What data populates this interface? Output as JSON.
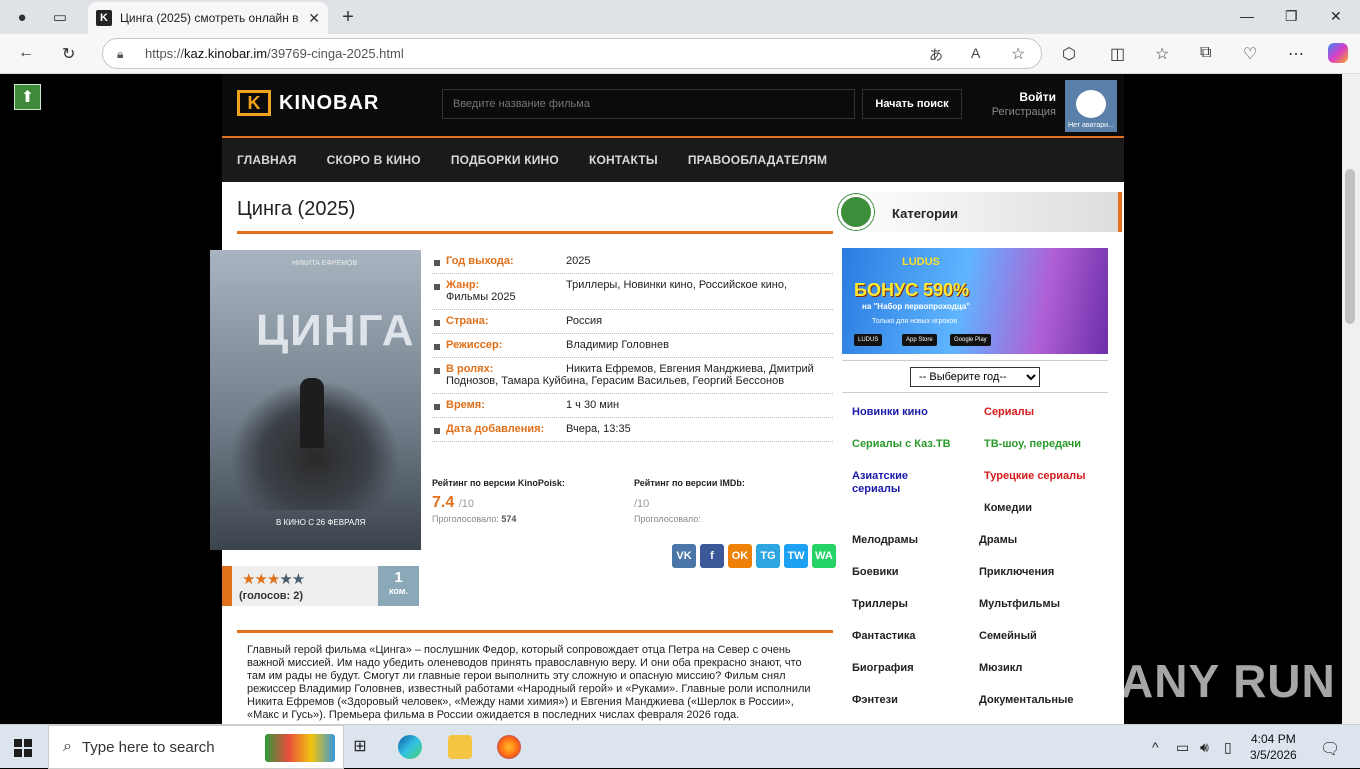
{
  "browser": {
    "tab_title": "Цинга (2025) смотреть онлайн в",
    "url_prefix": "https://",
    "url_domain": "kaz.kinobar.im",
    "url_path": "/39769-cinga-2025.html"
  },
  "site": {
    "logo_text": "KINOBAR",
    "search_placeholder": "Введите название фильма",
    "search_button": "Начать поиск",
    "login": "Войти",
    "register": "Регистрация",
    "avatar_caption": "Нет аватари...",
    "menu": [
      "ГЛАВНАЯ",
      "СКОРО В КИНО",
      "ПОДБОРКИ КИНО",
      "КОНТАКТЫ",
      "ПРАВООБЛАДАТЕЛЯМ"
    ]
  },
  "movie": {
    "title": "Цинга (2025)",
    "poster_title": "ЦИНГА",
    "poster_actor": "НИКИТА ЕФРЕМОВ",
    "poster_release": "В КИНО С 26 ФЕВРАЛЯ",
    "year_label": "Год выхода:",
    "year": "2025",
    "genre_label": "Жанр:",
    "genre": "Триллеры, Новинки кино, Российское кино,",
    "genre_cont": "Фильмы 2025",
    "country_label": "Страна:",
    "country": "Россия",
    "director_label": "Режиссер:",
    "director": "Владимир Головнев",
    "cast_label": "В ролях:",
    "cast": "Никита Ефремов, Евгения Манджиева, Дмитрий",
    "cast_cont": "Поднозов, Тамара Куйбина, Герасим Васильев, Георгий Бессонов",
    "time_label": "Время:",
    "time": "1 ч 30 мин",
    "added_label": "Дата добавления:",
    "added": "Вчера, 13:35",
    "votes": "(голосов: 2)",
    "stars": 3,
    "comments_count": "1",
    "comments_label": "ком."
  },
  "ratings": {
    "kp_label": "Рейтинг по версии KinoPoisk:",
    "kp_score": "7.4",
    "kp_max": "/10",
    "kp_votes_label": "Проголосовало:",
    "kp_votes": "574",
    "imdb_label": "Рейтинг по версии IMDb:",
    "imdb_max": "/10",
    "imdb_votes_label": "Проголосовало:"
  },
  "social": [
    "VK",
    "f",
    "OK",
    "TG",
    "TW",
    "WA"
  ],
  "description": "Главный герой фильма «Цинга» – послушник Федор, который сопровождает отца Петра на Север с очень важной миссией. Им надо убедить оленеводов принять православную веру. И они оба прекрасно знают, что там им рады не будут. Смогут ли главные герои выполнить эту сложную и опасную миссию? Фильм снял режиссер Владимир Головнев, известный работами «Народный герой» и «Руками». Главные роли исполнили Никита Ефремов («Здоровый человек», «Между нами химия») и Евгения Манджиева («Шерлок в России», «Макс и Гусь»). Премьера фильма в России ожидается в последних числах февраля 2026 года.",
  "sidebar": {
    "title": "Категории",
    "banner_brand": "LUDUS",
    "banner_bonus": "БОНУС 590%",
    "banner_line": "на \"Набор первопроходца\"",
    "banner_small": "Только для новых игроков",
    "banner_btn1": "LUDUS",
    "banner_btn2": "App Store",
    "banner_btn3": "Google Play",
    "year_select": "-- Выберите год--",
    "cats": [
      "Новинки кино",
      "Сериалы",
      "Сериалы с Каз.ТВ",
      "ТВ-шоу, передачи",
      "Азиатские сериалы",
      "Турецкие сериалы",
      "Комедии",
      "Мелодрамы",
      "Драмы",
      "Боевики",
      "Приключения",
      "Триллеры",
      "Мультфильмы",
      "Фантастика",
      "Семейный",
      "Биография",
      "Мюзикл",
      "Фэнтези",
      "Документальные"
    ],
    "cat_colors": {
      "blue": "#1a1aa8",
      "red": "#d41a1a",
      "green": "#2a9a2a",
      "black": "#222222"
    }
  },
  "taskbar": {
    "search_placeholder": "Type here to search",
    "time": "4:04 PM",
    "date": "3/5/2026"
  },
  "watermark": "ANY RUN"
}
